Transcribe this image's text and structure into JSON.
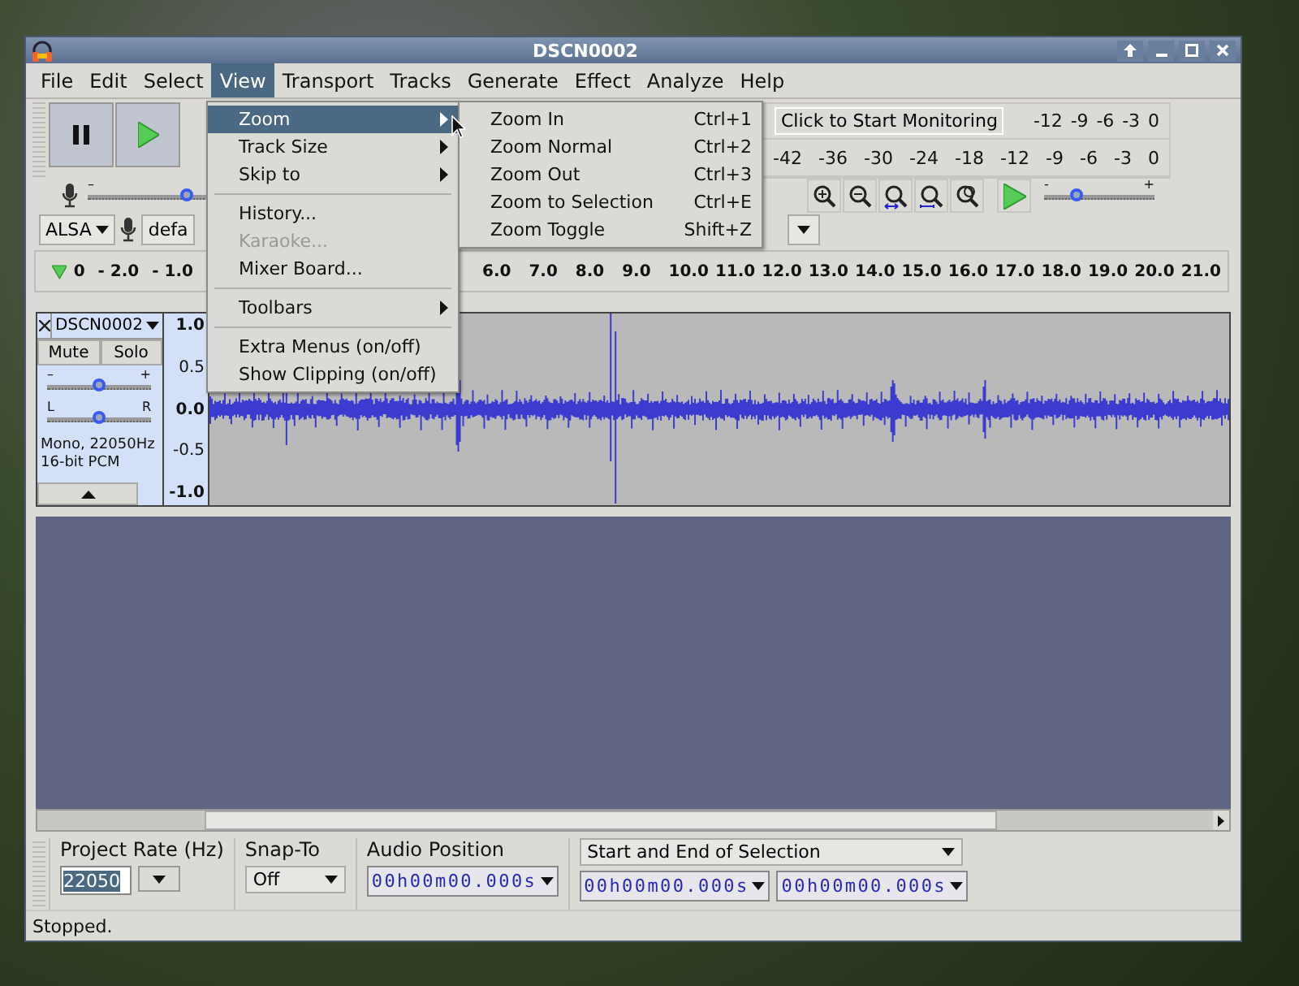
{
  "window": {
    "title": "DSCN0002"
  },
  "menubar": [
    {
      "label": "File",
      "selected": false
    },
    {
      "label": "Edit",
      "selected": false
    },
    {
      "label": "Select",
      "selected": false
    },
    {
      "label": "View",
      "selected": true
    },
    {
      "label": "Transport",
      "selected": false
    },
    {
      "label": "Tracks",
      "selected": false
    },
    {
      "label": "Generate",
      "selected": false
    },
    {
      "label": "Effect",
      "selected": false
    },
    {
      "label": "Analyze",
      "selected": false
    },
    {
      "label": "Help",
      "selected": false
    }
  ],
  "view_menu": {
    "items": [
      {
        "kind": "submenu",
        "label": "Zoom",
        "selected": true,
        "disabled": false
      },
      {
        "kind": "submenu",
        "label": "Track Size",
        "selected": false,
        "disabled": false
      },
      {
        "kind": "submenu",
        "label": "Skip to",
        "selected": false,
        "disabled": false
      },
      {
        "kind": "separator"
      },
      {
        "kind": "item",
        "label": "History...",
        "selected": false,
        "disabled": false
      },
      {
        "kind": "item",
        "label": "Karaoke...",
        "selected": false,
        "disabled": true
      },
      {
        "kind": "item",
        "label": "Mixer Board...",
        "selected": false,
        "disabled": false
      },
      {
        "kind": "separator"
      },
      {
        "kind": "submenu",
        "label": "Toolbars",
        "selected": false,
        "disabled": false
      },
      {
        "kind": "separator"
      },
      {
        "kind": "item",
        "label": "Extra Menus (on/off)",
        "selected": false,
        "disabled": false
      },
      {
        "kind": "item",
        "label": "Show Clipping (on/off)",
        "selected": false,
        "disabled": false
      }
    ]
  },
  "zoom_submenu": {
    "items": [
      {
        "label": "Zoom In",
        "shortcut": "Ctrl+1"
      },
      {
        "label": "Zoom Normal",
        "shortcut": "Ctrl+2"
      },
      {
        "label": "Zoom Out",
        "shortcut": "Ctrl+3"
      },
      {
        "label": "Zoom to Selection",
        "shortcut": "Ctrl+E"
      },
      {
        "label": "Zoom Toggle",
        "shortcut": "Shift+Z"
      }
    ]
  },
  "meters": {
    "monitor_button": "Click to Start Monitoring",
    "record_scale": [
      "-12",
      "-9",
      "-6",
      "-3",
      "0"
    ],
    "playback_scale": [
      "-42",
      "-36",
      "-30",
      "-24",
      "-18",
      "-12",
      "-9",
      "-6",
      "-3",
      "0"
    ]
  },
  "recording_volume": {
    "min": "–",
    "level": 0.55
  },
  "play_at_speed": {
    "min": "-",
    "max": "+",
    "level": 0.3
  },
  "device": {
    "host": "ALSA",
    "input": "defa"
  },
  "ruler": {
    "left_labels": [
      "0",
      "- 2.0",
      "- 1.0"
    ],
    "right_labels": [
      "6.0",
      "7.0",
      "8.0",
      "9.0",
      "10.0",
      "11.0",
      "12.0",
      "13.0",
      "14.0",
      "15.0",
      "16.0",
      "17.0",
      "18.0",
      "19.0",
      "20.0",
      "21.0"
    ]
  },
  "track": {
    "name": "DSCN0002",
    "mute": "Mute",
    "solo": "Solo",
    "gain": {
      "min": "–",
      "max": "+",
      "level": 0.5
    },
    "pan": {
      "min": "L",
      "max": "R",
      "level": 0.5
    },
    "info": [
      "Mono, 22050Hz",
      "16-bit PCM"
    ],
    "scale": [
      "1.0",
      "0.5",
      "0.0",
      "-0.5",
      "-1.0"
    ]
  },
  "selection_toolbar": {
    "project_rate_label": "Project Rate (Hz)",
    "project_rate": "22050",
    "snap_to_label": "Snap-To",
    "snap_to": "Off",
    "audio_position_label": "Audio Position",
    "audio_position": "00h00m00.000s",
    "selection_mode": "Start and End of Selection",
    "selection_start": "00h00m00.000s",
    "selection_end": "00h00m00.000s"
  },
  "status_bar": {
    "text": "Stopped."
  }
}
